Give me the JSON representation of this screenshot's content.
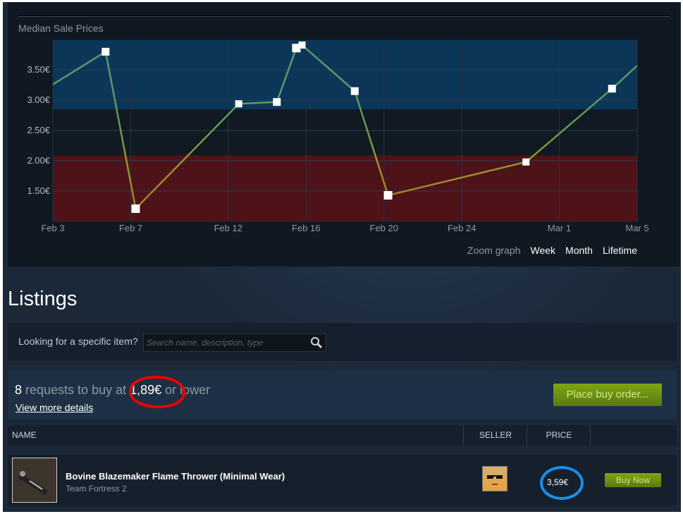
{
  "chart_section": {
    "title": "Median Sale Prices",
    "zoom": {
      "label": "Zoom graph",
      "options": [
        "Week",
        "Month",
        "Lifetime"
      ]
    }
  },
  "chart_data": {
    "type": "line",
    "title": "Median Sale Prices",
    "x_tick_labels": [
      "Feb 3",
      "Feb 7",
      "Feb 12",
      "Feb 16",
      "Feb 20",
      "Feb 24",
      "Mar 1",
      "Mar 5"
    ],
    "y_tick_labels": [
      "3.50€",
      "3.00€",
      "2.50€",
      "2.00€",
      "1.50€"
    ],
    "y_ticks": [
      3.5,
      3.0,
      2.5,
      2.0,
      1.5
    ],
    "ylim": [
      1.0,
      3.99
    ],
    "xlim": [
      "Feb 3 00:00",
      "Mar 5 00:00"
    ],
    "grid": true,
    "bands": [
      {
        "from": 2.85,
        "to": 3.99,
        "color": "#0c3658"
      },
      {
        "from": 1.0,
        "to": 2.09,
        "color": "#4e1219"
      }
    ],
    "series": [
      {
        "points": [
          {
            "x": "Feb 3 00:00",
            "y": 3.26
          },
          {
            "x": "Feb 5 17:00",
            "y": 3.8
          },
          {
            "x": "Feb 7 06:00",
            "y": 1.21
          },
          {
            "x": "Feb 12 13:00",
            "y": 2.94
          },
          {
            "x": "Feb 14 12:00",
            "y": 2.97
          },
          {
            "x": "Feb 15 12:00",
            "y": 3.86
          },
          {
            "x": "Feb 15 19:00",
            "y": 3.91
          },
          {
            "x": "Feb 18 12:00",
            "y": 3.15
          },
          {
            "x": "Feb 20 05:00",
            "y": 1.43
          },
          {
            "x": "Feb 27 07:00",
            "y": 1.98
          },
          {
            "x": "Mar 3 17:00",
            "y": 3.19
          },
          {
            "x": "Mar 5 00:00",
            "y": 3.57
          }
        ]
      }
    ]
  },
  "listings": {
    "title": "Listings",
    "search": {
      "label": "Looking for a specific item?",
      "placeholder": "Search name, description, type"
    },
    "buy_orders": {
      "count": "8",
      "text_before": " requests to buy at ",
      "price": "1,89€",
      "text_after": " or lower",
      "details_link": "View more details",
      "button": "Place buy order..."
    },
    "table": {
      "headers": [
        "NAME",
        "SELLER",
        "PRICE"
      ],
      "rows": [
        {
          "name": "Bovine Blazemaker Flame Thrower (Minimal Wear)",
          "game": "Team Fortress 2",
          "price": "3,59€",
          "button": "Buy Now"
        }
      ]
    }
  },
  "annotations": {
    "circle_red_color": "#ee0000",
    "circle_blue_color": "#1a8ee8"
  }
}
